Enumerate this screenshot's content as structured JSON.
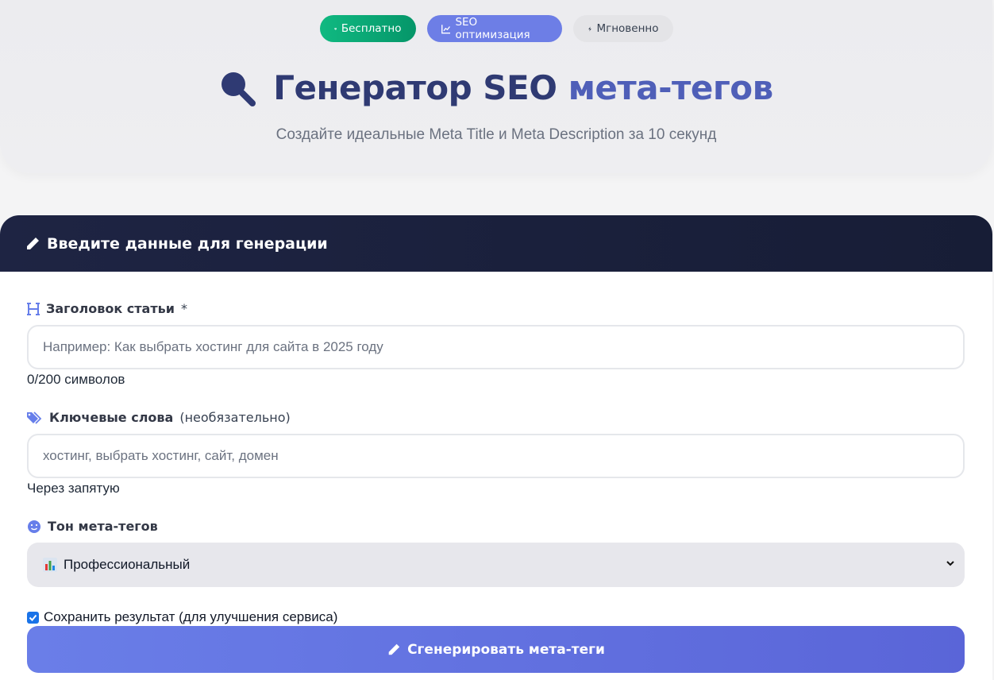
{
  "colors": {
    "accent": "#667eea",
    "green": "#10b981",
    "dark": "#1e2443"
  },
  "badges": [
    {
      "label": "Бесплатно",
      "icon": "gem-icon"
    },
    {
      "label": "SEO оптимизация",
      "icon": "chart-line-icon"
    },
    {
      "label": "Мгновенно",
      "icon": "bolt-icon"
    }
  ],
  "hero": {
    "title_part1": "Генератор SEO",
    "title_part2": "мета-тегов",
    "subtitle": "Создайте идеальные Meta Title и Meta Description за 10 секунд"
  },
  "form": {
    "header": "Введите данные для генерации",
    "title_field": {
      "label": "Заголовок статьи",
      "required_mark": "*",
      "placeholder": "Например: Как выбрать хостинг для сайта в 2025 году",
      "counter": "0/200 символов"
    },
    "keywords_field": {
      "label": "Ключевые слова",
      "optional": "(необязательно)",
      "placeholder": "хостинг, выбрать хостинг, сайт, домен",
      "hint": "Через запятую"
    },
    "tone_field": {
      "label": "Тон мета-тегов",
      "selected": "Профессиональный"
    },
    "save_checkbox": {
      "label": "Сохранить результат (для улучшения сервиса)",
      "checked": true
    },
    "submit_label": "Сгенерировать мета-теги"
  }
}
